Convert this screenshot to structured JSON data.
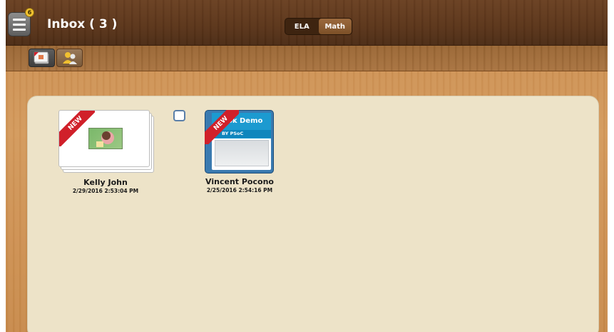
{
  "header": {
    "title": "Inbox ( 3 )",
    "badge_count": "6",
    "menu_icon": "hamburger-menu-icon"
  },
  "subjects": [
    {
      "label": "ELA",
      "selected": false
    },
    {
      "label": "Math",
      "selected": true
    }
  ],
  "toolbar": {
    "buttons": [
      {
        "icon": "card-view-icon",
        "active": true
      },
      {
        "icon": "people-view-icon",
        "active": false
      }
    ]
  },
  "items": [
    {
      "name": "Kelly John",
      "date": "2/29/2016 2:53:04 PM",
      "badge": "NEW",
      "type": "card-stack"
    },
    {
      "name": "Vincent Pocono",
      "date": "2/25/2016 2:54:16 PM",
      "badge": "NEW",
      "type": "notebook",
      "book_title": "ok Demo",
      "book_sub": "BY PSoC"
    }
  ],
  "colors": {
    "badge_red": "#d0202a",
    "panel_bg": "#ede3c8",
    "book_blue": "#1c9ad0"
  }
}
